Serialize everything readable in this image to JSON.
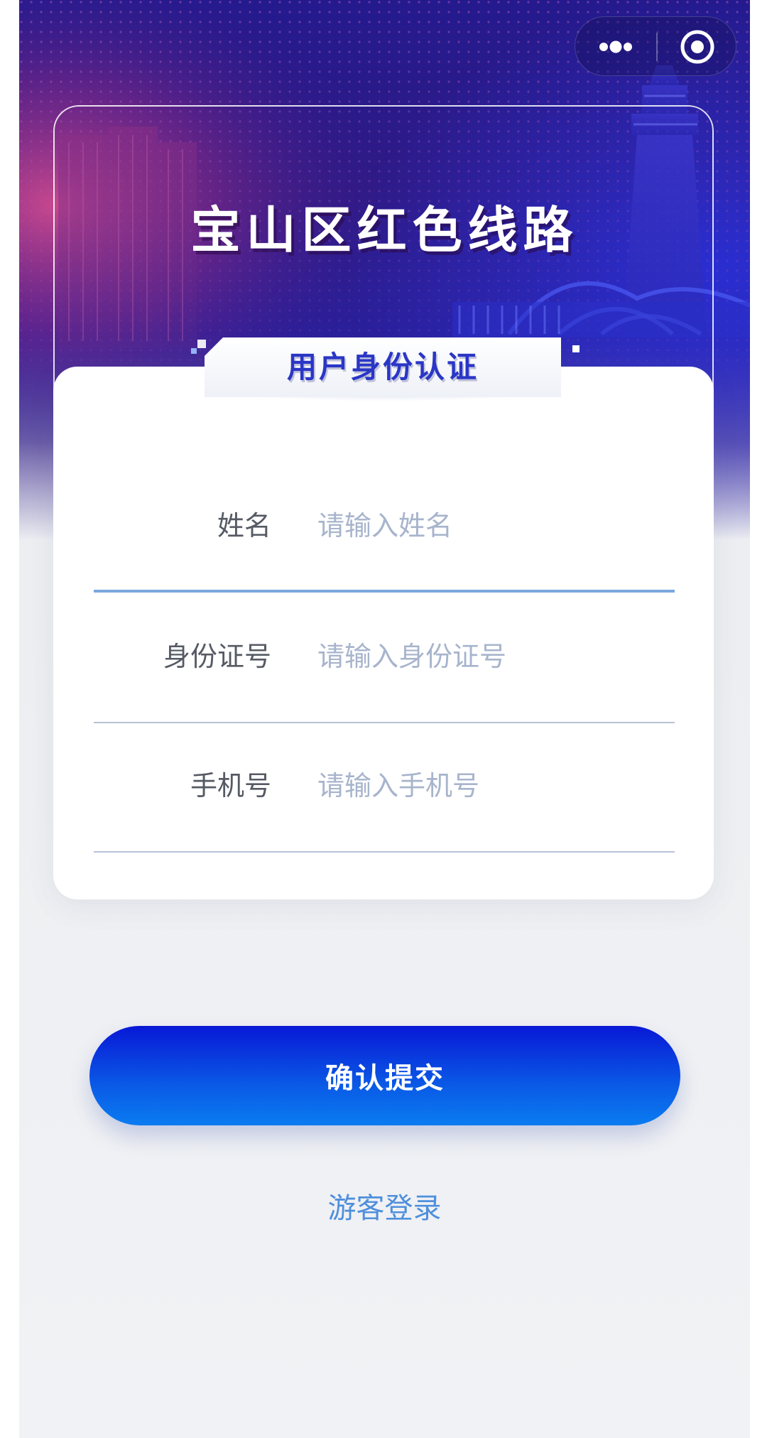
{
  "banner": {
    "title": "宝山区红色线路"
  },
  "capsule": {
    "more_icon": "more-dots-icon",
    "close_icon": "target-circle-icon"
  },
  "section": {
    "title": "用户身份认证"
  },
  "form": {
    "name": {
      "label": "姓名",
      "placeholder": "请输入姓名",
      "value": ""
    },
    "id_number": {
      "label": "身份证号",
      "placeholder": "请输入身份证号",
      "value": ""
    },
    "phone": {
      "label": "手机号",
      "placeholder": "请输入手机号",
      "value": ""
    }
  },
  "actions": {
    "submit_label": "确认提交",
    "guest_label": "游客登录"
  },
  "colors": {
    "hero_top": "#231a8c",
    "hero_magenta": "#a8307a",
    "section_title": "#2a36c6",
    "button_top": "#0818d6",
    "button_bottom": "#0a7cf0",
    "guest_link": "#4f8fdc",
    "active_underline": "#7aa8de"
  }
}
